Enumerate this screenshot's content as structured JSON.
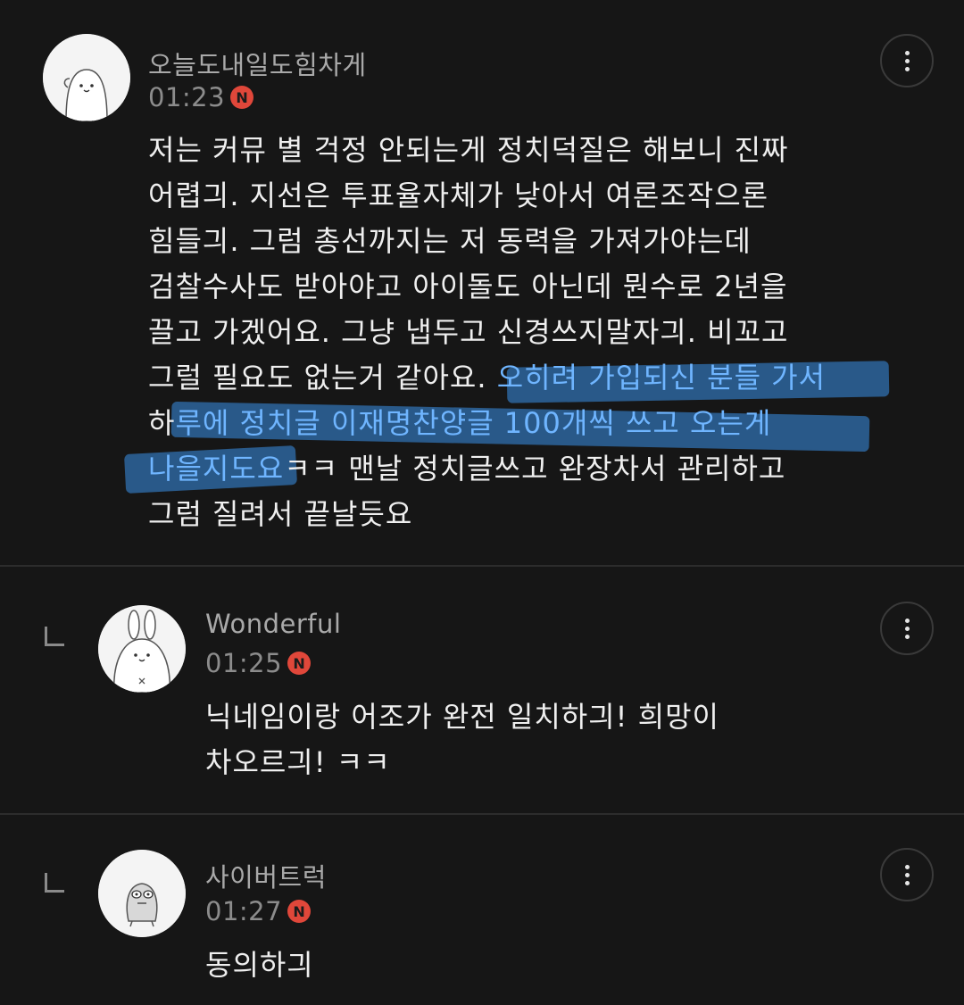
{
  "comments": [
    {
      "username": "오늘도내일도힘차게",
      "time": "01:23",
      "badge": "N",
      "avatar_icon": "white-blob-character-icon",
      "lines": [
        {
          "pre": "저는 커뮤 별 걱정 안되는게 정치덕질은 해보니 진짜",
          "hl": "",
          "post": ""
        },
        {
          "pre": "어렵긔. 지선은 투표율자체가 낮아서 여론조작으론",
          "hl": "",
          "post": ""
        },
        {
          "pre": "힘들긔. 그럼 총선까지는 저 동력을 가져가야는데",
          "hl": "",
          "post": ""
        },
        {
          "pre": "검찰수사도 받아야고 아이돌도 아닌데 뭔수로 2년을",
          "hl": "",
          "post": ""
        },
        {
          "pre": "끌고 가겠어요. 그냥 냅두고 신경쓰지말자긔. 비꼬고",
          "hl": "",
          "post": ""
        },
        {
          "pre": "그럴 필요도 없는거 같아요. ",
          "hl": "오히려 가입되신 분들 가서",
          "post": ""
        },
        {
          "pre": "하",
          "hl": "루에 정치글 이재명찬양글 100개씩 쓰고 오는게",
          "post": ""
        },
        {
          "pre": "",
          "hl": "나을지도요",
          "post": "ㅋㅋ 맨날 정치글쓰고 완장차서 관리하고"
        },
        {
          "pre": "그럼 질려서 끝날듯요",
          "hl": "",
          "post": ""
        }
      ]
    },
    {
      "username": "Wonderful",
      "time": "01:25",
      "badge": "N",
      "avatar_icon": "white-rabbit-character-icon",
      "lines": [
        {
          "pre": "닉네임이랑 어조가 완전 일치하긔! 희망이",
          "hl": "",
          "post": ""
        },
        {
          "pre": "차오르긔! ㅋㅋ",
          "hl": "",
          "post": ""
        }
      ]
    },
    {
      "username": "사이버트럭",
      "time": "01:27",
      "badge": "N",
      "avatar_icon": "small-creature-character-icon",
      "lines": [
        {
          "pre": "동의하긔",
          "hl": "",
          "post": ""
        }
      ]
    }
  ],
  "colors": {
    "background": "#161616",
    "highlight_stroke": "#2b5f94",
    "highlight_text": "#6fb5ff",
    "badge": "#e0473a"
  }
}
